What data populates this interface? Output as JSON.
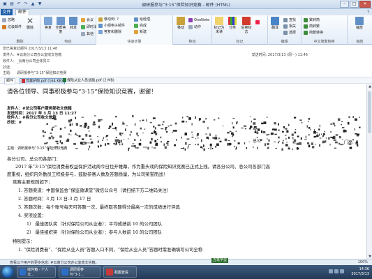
{
  "window": {
    "title": "调研报参与“3·15”保险知识竞赛 - 邮件 (HTML)",
    "controls": {
      "min": "–",
      "max": "□",
      "close": "✕"
    }
  },
  "tabs": {
    "file": "文件",
    "message": "邮件"
  },
  "ribbon": {
    "groups": {
      "delete": "删除",
      "respond": "响应",
      "quicksteps": "快速步骤",
      "move": "移动",
      "tags": "标记",
      "editing": "编辑",
      "translate": "中文简繁转换",
      "zoom": "缩放"
    },
    "buttons": {
      "ignore": "忽略",
      "junk": "垃圾邮件",
      "delete": "删除",
      "reply": "答复",
      "reply_all": "全部答复",
      "forward": "转发",
      "meeting": "会议",
      "im": "即时消息",
      "more": "其他",
      "qs_move": "移动到: ?",
      "qs_manager": "给经理",
      "qs_team": "小组电子邮件",
      "qs_done": "完成",
      "qs_reply_delete": "答复和删除",
      "qs_new": "新建",
      "move": "移动",
      "onenote": "OneNote",
      "actions": "动作",
      "mark_unread": "标记为未读",
      "categorize": "分类",
      "followup": "后续标志",
      "translate": "翻译",
      "find": "查找",
      "related": "相关",
      "select": "选择",
      "to_trad": "繁转简",
      "to_simp": "简转繁",
      "convert": "简繁转换",
      "zoom": "缩放"
    }
  },
  "header": {
    "info": "您已答复此邮件 2017/3/13 11:48",
    "from_label": "发件人:",
    "from": "#云南分公司办公室收文信箱",
    "to_label": "收件人:",
    "to": "_云南分公司全体员工",
    "cc_label": "抄送:",
    "subject_label": "主题:",
    "subject": "调研报参与“3·15”保险知识竞赛",
    "sent_label": "发送时间:",
    "sent": "2017/3/13 (周一) 11:46"
  },
  "attachments": [
    {
      "name": "邮件",
      "kind": "message"
    },
    {
      "name": "竞赛护照.pdf (164 KB)",
      "kind": "pdf"
    },
    {
      "name": "保险从业人员试题.pdf (2 MB)",
      "kind": "xlsx"
    }
  ],
  "body": {
    "title": "请各位领导、同事积极参与“3·15”保险知识竞赛，谢谢！",
    "fwd_lines": [
      "发件人：#总公司客户服务部收文信箱",
      "发送时间：2017 年 3 月 13 日 11:27",
      "收件人：#各分公司收文信箱",
      "抄送：#"
    ],
    "fragment_right": "门高",
    "fragment_mid": "、总公",
    "fragment_subject": "主题：调研报参与“3·15”保险知识竞赛",
    "paragraphs": [
      "各分公司、总公司各部门：",
      "2017 年“3·15”保险消费者权益保护活动周今日拉开帷幕，作为重头戏的保险知识竞赛已正式上线。请各分公司、总公司各部门高",
      "度重视，组织内外勤员工积极参与，鼓励参赛人数及答题质量，为公司荣誉而战！",
      "竞赛主要规则如下：",
      "1.  答题渠道：中国保监会“保监微课堂”微信公众号（请扫描下方二维码关注）",
      "2.  答题时间：3 月 13 日-3 月 17 日",
      "3.  答题次数：每个账号每天可答题一次，最终取答题得分最高一次的成绩进行评选",
      "4.  奖项设置：",
      "1）  最佳团队奖（针对保险公司从业者）：平均成绩前 10 的公司团队",
      "2）  最佳组织奖（针对保险公司从业者）：参与人数前 10 的公司团队",
      "特别提示：",
      "1.  “保险消费者”、“保险从业人员”答题入口不同，“保险从业人员”答题时需准确填写公司全称"
    ]
  },
  "status": {
    "text": "查看以下用户的更多信息: #云南分公司办公室收文信箱。",
    "zoom": "100%",
    "notify": "五笔字型"
  },
  "taskbar": {
    "apps": [
      "收件箱 - 个人文...",
      "调研报参与“3·1...",
      "截图查看"
    ],
    "time": "14:36",
    "date": "2017/3/13"
  }
}
